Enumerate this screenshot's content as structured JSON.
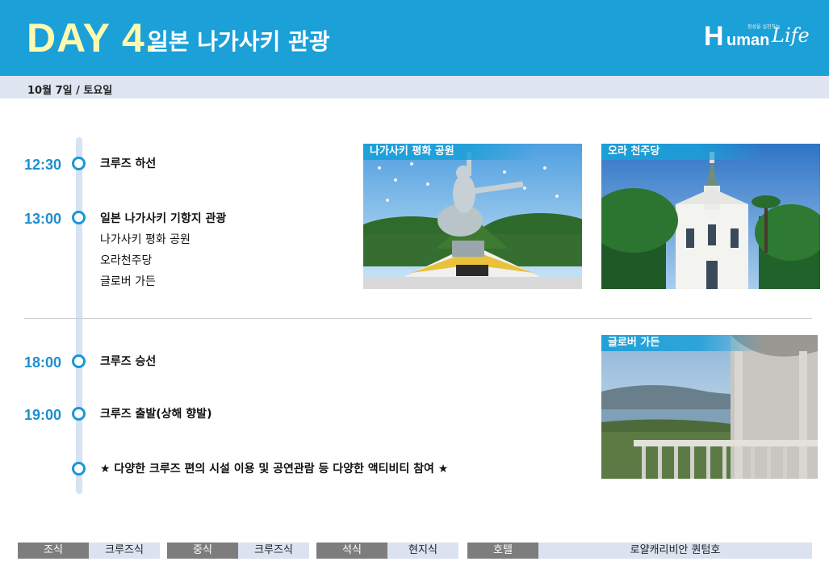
{
  "header": {
    "day_label": "DAY 4.",
    "day_title": "일본 나가사키 관광",
    "logo": {
      "h": "H",
      "uman": "uman",
      "life": "Life",
      "tagline": "정성을 실천하는"
    }
  },
  "date": "10월 7일 / 토요일",
  "schedule": [
    {
      "time": "12:30",
      "items": [
        "크루즈 하선"
      ]
    },
    {
      "time": "13:00",
      "items": [
        "일본 나가사키 기항지 관광",
        "나가사키 평화 공원",
        "오라천주당",
        "글로버 가든"
      ]
    },
    {
      "time": "18:00",
      "items": [
        "크루즈 승선"
      ]
    },
    {
      "time": "19:00",
      "items": [
        "크루즈 출발(상해 향발)"
      ]
    },
    {
      "time": "",
      "items": [
        "★ 다양한 크루즈 편의 시설 이용 및 공연관람 등 다양한 액티비티 참여 ★"
      ]
    }
  ],
  "photos": [
    {
      "label": "나가사키 평화 공원"
    },
    {
      "label": "오라 천주당"
    },
    {
      "label": "글로버 가든"
    }
  ],
  "meals": [
    {
      "key": "조식",
      "value": "크루즈식"
    },
    {
      "key": "중식",
      "value": "크루즈식"
    },
    {
      "key": "석식",
      "value": "현지식"
    },
    {
      "key": "호텔",
      "value": "로얄캐리비안 퀀텀호"
    }
  ],
  "colors": {
    "accent": "#1ba0d8",
    "day_yellow": "#fff9b0",
    "time_blue": "#1c8fcf",
    "date_bar": "#dfe5f1",
    "meal_key": "#7d7d7d",
    "meal_value": "#dbe3f0"
  }
}
